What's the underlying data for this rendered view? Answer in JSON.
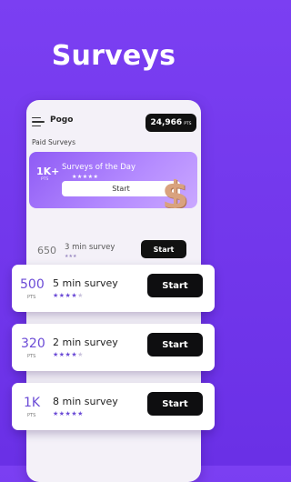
{
  "headline": "Surveys",
  "app": {
    "name": "Pogo",
    "points_value": "24,966",
    "points_unit": "PTS",
    "section_label": "Paid Surveys"
  },
  "featured": {
    "points": "1K+",
    "points_unit": "PTS",
    "title": "Surveys of the Day",
    "stars": "★★★★★",
    "button": "Start"
  },
  "inner_row": {
    "points": "650",
    "title": "3 min survey",
    "stars": "★★★",
    "button": "Start"
  },
  "cards": [
    {
      "points": "500",
      "unit": "PTS",
      "title": "5 min survey",
      "stars_on": "★★★★",
      "stars_off": "★",
      "button": "Start"
    },
    {
      "points": "320",
      "unit": "PTS",
      "title": "2 min survey",
      "stars_on": "★★★★",
      "stars_off": "★",
      "button": "Start"
    },
    {
      "points": "1K",
      "unit": "PTS",
      "title": "8 min survey",
      "stars_on": "★★★★★",
      "stars_off": "",
      "button": "Start"
    }
  ],
  "colors": {
    "background": "#7b3ff2",
    "accent": "#6b4bd6",
    "button": "#0e0e10"
  }
}
